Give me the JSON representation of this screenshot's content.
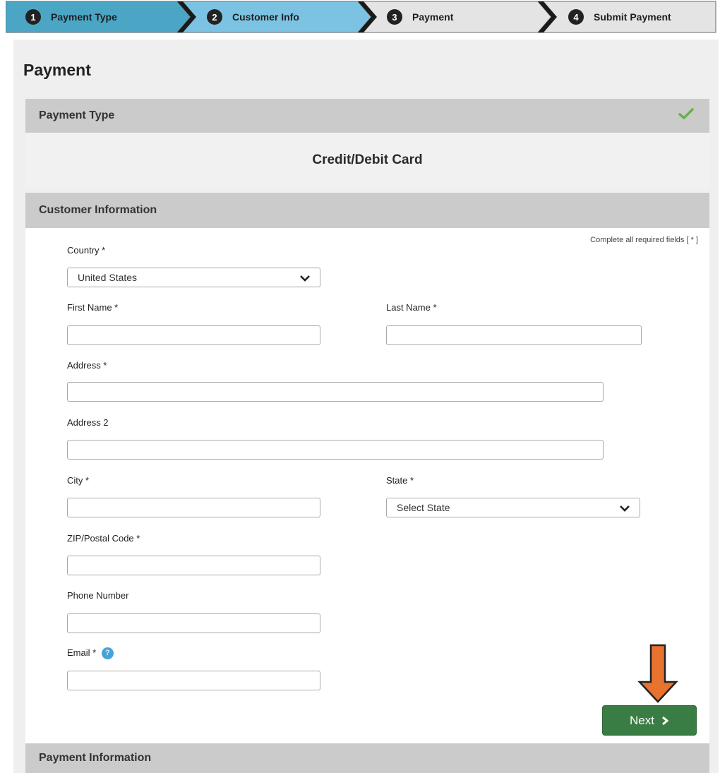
{
  "steps": [
    {
      "num": "1",
      "label": "Payment Type",
      "color": "#4ba6c6"
    },
    {
      "num": "2",
      "label": "Customer Info",
      "color": "#7cc3e3"
    },
    {
      "num": "3",
      "label": "Payment",
      "color": "#e4e4e4"
    },
    {
      "num": "4",
      "label": "Submit Payment",
      "color": "#e4e4e4"
    }
  ],
  "page": {
    "title": "Payment"
  },
  "payment_type": {
    "header": "Payment Type",
    "value": "Credit/Debit Card",
    "status_icon": "check-icon"
  },
  "customer_info": {
    "header": "Customer Information",
    "required_note": "Complete all required fields [ * ]",
    "country": {
      "label": "Country *",
      "value": "United States"
    },
    "first_name": {
      "label": "First Name *",
      "value": ""
    },
    "last_name": {
      "label": "Last Name *",
      "value": ""
    },
    "address": {
      "label": "Address *",
      "value": ""
    },
    "address2": {
      "label": "Address 2",
      "value": ""
    },
    "city": {
      "label": "City *",
      "value": ""
    },
    "state": {
      "label": "State *",
      "value": "Select State"
    },
    "zip": {
      "label": "ZIP/Postal Code *",
      "value": ""
    },
    "phone": {
      "label": "Phone Number",
      "value": ""
    },
    "email": {
      "label": "Email *",
      "value": "",
      "help": "?"
    },
    "next_button": "Next"
  },
  "payment_info": {
    "header": "Payment Information"
  },
  "colors": {
    "accent_button": "#3a7d44",
    "annotation_arrow": "#e8732e"
  }
}
